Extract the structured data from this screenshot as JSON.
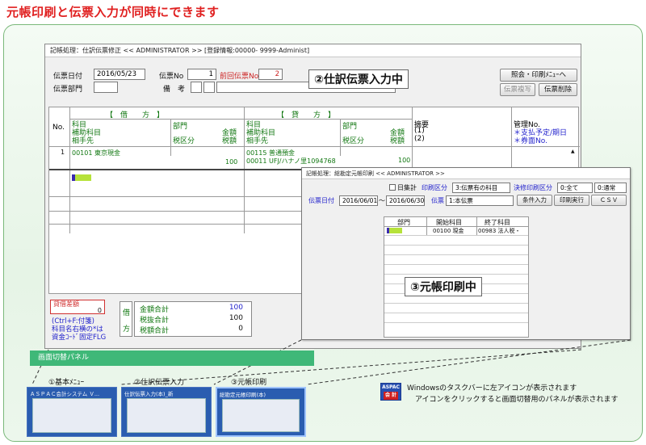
{
  "headline": "元帳印刷と伝票入力が同時にできます",
  "window_main": {
    "title": "記帳処理：仕訳伝票修正 << ADMINISTRATOR >> [登録情報:00000- 9999-Administ]",
    "labels": {
      "date": "伝票日付",
      "slip_no": "伝票No",
      "prev_slip_no": "前回伝票No",
      "dept": "伝票部門",
      "remarks": "備　考"
    },
    "values": {
      "date": "2016/05/23",
      "slip_no": "1",
      "prev_slip_no": "2"
    },
    "buttons": {
      "inquiry": "照会・印刷ﾒﾆｭｰへ",
      "copy": "伝票複写",
      "delete": "伝票削除"
    },
    "overlay": "②仕訳伝票入力中",
    "grid": {
      "no_header": "No.",
      "debit_header": "【　借　　方　】",
      "credit_header": "【　貸　　方　】",
      "debit_cols": [
        "科目",
        "補助科目",
        "相手先"
      ],
      "dept_col": "部門",
      "tax_col": "税区分",
      "amount_col": "金額",
      "tax_amount_col": "税額",
      "summary_cols": [
        "摘要",
        "(1)",
        "(2)"
      ],
      "mgmt_cols": [
        "管理No.",
        "＊支払予定/期日",
        "＊券面No."
      ],
      "rows": [
        {
          "no": "1",
          "debit_account": "00101 東京現金",
          "debit_amount": "100",
          "credit_account": "00115 普通預金",
          "credit_sub": "00011 UFJ/ハナノ里1094768",
          "credit_amount": "100"
        }
      ]
    },
    "footer": {
      "diff_label": "貸借差額",
      "diff_value": "0",
      "hint1": "(Ctrl+F:付箋)",
      "hint2": "科目名右横の*は",
      "hint3": "資金ｺｰﾄﾞ固定FLG",
      "side_debit": "借",
      "side_credit": "方",
      "totals_labels": [
        "金額合計",
        "税抜合計",
        "税額合計"
      ],
      "totals_values": [
        "100",
        "100",
        "0"
      ]
    }
  },
  "window_ledger": {
    "title": "記帳処理：総勘定元帳印刷 << ADMINISTRATOR >>",
    "daily_label": "日集計",
    "print_type_label": "印刷区分",
    "print_type_value": "3:伝票有の科目",
    "settle_label": "決修印刷区分",
    "settle_value": "0:全て",
    "settle_value2": "0:通常",
    "date_label": "伝票日付",
    "date_from": "2016/06/01",
    "date_sep": "～",
    "date_to": "2016/06/30",
    "slip_label": "伝票",
    "slip_value": "1:本伝票",
    "buttons": [
      "条件入力",
      "印刷実行",
      "ＣＳＶ"
    ],
    "grid_cols": [
      "部門",
      "開始科目",
      "終了科目"
    ],
    "grid_row": [
      "",
      "00100 現金",
      "00983 法人税・"
    ],
    "overlay": "③元帳印刷中"
  },
  "panel": {
    "bar_label": "画面切替パネル",
    "thumbs": [
      {
        "caption": "①基本ﾒﾆｭｰ",
        "title": "ＡＳＰＡＣ会計システム Ｖ..."
      },
      {
        "caption": "②仕訳伝票入力",
        "title": "仕訳伝票入力(本)_新"
      },
      {
        "caption": "③元帳印刷",
        "title": "総勘定元帳印刷(本)"
      }
    ]
  },
  "icon_badge": {
    "top": "ASPAC",
    "bottom": "会 計"
  },
  "notes": [
    "Windowsのタスクバーに左アイコンが表示されます",
    "アイコンをクリックすると画面切替用のパネルが表示されます"
  ],
  "colors": {
    "headline": "#e02020",
    "panel_bar": "#3fb878",
    "taskbar_thumb": "#2a5db0",
    "frame_border": "#7ab87a"
  }
}
